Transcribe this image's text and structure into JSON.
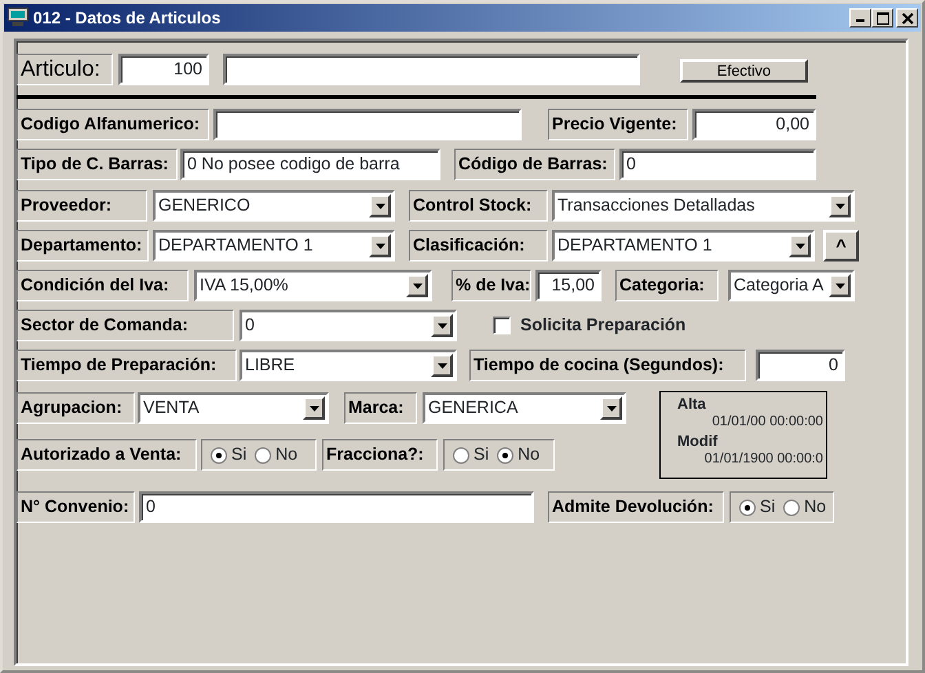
{
  "window": {
    "title": "012 - Datos de Articulos"
  },
  "rows": [
    {
      "items": [
        {
          "kind": "label",
          "text": "Articulo:"
        },
        {
          "kind": "text",
          "value": "100"
        },
        {
          "kind": "text"
        },
        {
          "kind": "button",
          "text": "Efectivo"
        }
      ]
    },
    {
      "items": [
        {
          "kind": "rule"
        }
      ]
    },
    {
      "items": [
        {
          "kind": "label",
          "text": "Codigo Alfanumerico:"
        },
        {
          "kind": "text"
        },
        {
          "kind": "label",
          "text": "Precio Vigente:"
        },
        {
          "kind": "text",
          "value": "0,00"
        }
      ]
    },
    {
      "items": [
        {
          "kind": "label",
          "text": "Tipo de C. Barras:"
        },
        {
          "kind": "text",
          "value": "0 No posee codigo de barra"
        },
        {
          "kind": "label",
          "text": "Código de Barras:"
        },
        {
          "kind": "text",
          "value": "0"
        }
      ]
    },
    {
      "items": [
        {
          "kind": "label",
          "text": "Proveedor:"
        },
        {
          "kind": "combo",
          "value": "GENERICO"
        },
        {
          "kind": "label",
          "text": "Control Stock:"
        },
        {
          "kind": "combo",
          "value": "Transacciones Detalladas"
        }
      ]
    },
    {
      "items": [
        {
          "kind": "label",
          "text": "Departamento:"
        },
        {
          "kind": "combo",
          "value": "DEPARTAMENTO 1"
        },
        {
          "kind": "label",
          "text": "Clasificación:"
        },
        {
          "kind": "combo",
          "value": "DEPARTAMENTO 1"
        },
        {
          "kind": "button",
          "text": "^"
        }
      ]
    },
    {
      "items": [
        {
          "kind": "label",
          "text": "Condición del Iva:"
        },
        {
          "kind": "combo",
          "value": "IVA 15,00%"
        },
        {
          "kind": "label",
          "text": "% de Iva:"
        },
        {
          "kind": "text",
          "value": "15,00"
        },
        {
          "kind": "label",
          "text": "Categoria:"
        },
        {
          "kind": "combo",
          "value": "Categoria A"
        }
      ]
    },
    {
      "items": [
        {
          "kind": "label",
          "text": "Sector de Comanda:"
        },
        {
          "kind": "combo",
          "value": "0"
        },
        {
          "kind": "checkbox",
          "text": "Solicita Preparación",
          "checked": false
        }
      ]
    },
    {
      "items": [
        {
          "kind": "label",
          "text": "Tiempo de Preparación:"
        },
        {
          "kind": "combo",
          "value": "LIBRE"
        },
        {
          "kind": "label",
          "text": "Tiempo de cocina (Segundos):"
        },
        {
          "kind": "text",
          "value": "0"
        }
      ]
    },
    {
      "items": [
        {
          "kind": "label",
          "text": "Agrupacion:"
        },
        {
          "kind": "combo",
          "value": "VENTA"
        },
        {
          "kind": "label",
          "text": "Marca:"
        },
        {
          "kind": "combo",
          "value": "GENERICA"
        }
      ]
    },
    {
      "items": [
        {
          "kind": "label",
          "text": "Autorizado a Venta:"
        },
        {
          "kind": "radio",
          "options": [
            {
              "label": "Si",
              "selected": true
            },
            {
              "label": "No",
              "selected": false
            }
          ]
        },
        {
          "kind": "label",
          "text": "Fracciona?:"
        },
        {
          "kind": "radio",
          "options": [
            {
              "label": "Si",
              "selected": false
            },
            {
              "label": "No",
              "selected": true
            }
          ]
        }
      ]
    },
    {
      "items": [
        {
          "kind": "label",
          "text": "N° Convenio:"
        },
        {
          "kind": "text",
          "value": "0"
        },
        {
          "kind": "label",
          "text": "Admite Devolución:"
        },
        {
          "kind": "radio",
          "options": [
            {
              "label": "Si",
              "selected": true
            },
            {
              "label": "No",
              "selected": false
            }
          ]
        }
      ]
    }
  ],
  "audit": [
    {
      "label": "Alta",
      "value": "01/01/00 00:00:00"
    },
    {
      "label": "Modif",
      "value": "01/01/1900 00:00:0"
    }
  ]
}
